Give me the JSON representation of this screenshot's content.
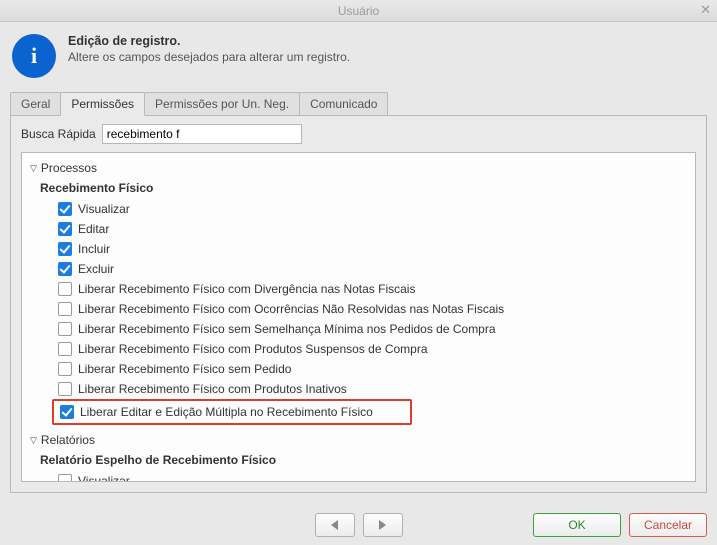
{
  "window": {
    "title": "Usuário"
  },
  "header": {
    "title": "Edição de registro.",
    "subtitle": "Altere os campos desejados para alterar um registro."
  },
  "tabs": [
    {
      "label": "Geral",
      "active": false
    },
    {
      "label": "Permissões",
      "active": true
    },
    {
      "label": "Permissões por Un. Neg.",
      "active": false
    },
    {
      "label": "Comunicado",
      "active": false
    }
  ],
  "search": {
    "label": "Busca Rápida",
    "value": "recebimento f"
  },
  "groups": {
    "processos": {
      "label": "Processos",
      "subgroups": {
        "recebimento_fisico": {
          "label": "Recebimento Físico",
          "items": [
            {
              "label": "Visualizar",
              "checked": true
            },
            {
              "label": "Editar",
              "checked": true
            },
            {
              "label": "Incluir",
              "checked": true
            },
            {
              "label": "Excluir",
              "checked": true
            },
            {
              "label": "Liberar Recebimento Físico com Divergência nas Notas Fiscais",
              "checked": false
            },
            {
              "label": "Liberar Recebimento Físico com Ocorrências Não Resolvidas nas Notas Fiscais",
              "checked": false
            },
            {
              "label": "Liberar Recebimento Físico sem Semelhança Mínima nos Pedidos de Compra",
              "checked": false
            },
            {
              "label": "Liberar Recebimento Físico com Produtos Suspensos de Compra",
              "checked": false
            },
            {
              "label": "Liberar Recebimento Físico sem Pedido",
              "checked": false
            },
            {
              "label": "Liberar Recebimento Físico com Produtos Inativos",
              "checked": false
            },
            {
              "label": "Liberar Editar e Edição Múltipla no Recebimento Físico",
              "checked": true,
              "highlight": true
            }
          ]
        }
      }
    },
    "relatorios": {
      "label": "Relatórios",
      "subgroups": {
        "espelho": {
          "label": "Relatório Espelho de Recebimento Físico",
          "items": [
            {
              "label": "Visualizar",
              "checked": false
            }
          ]
        }
      }
    }
  },
  "footer": {
    "ok_label": "OK",
    "cancel_label": "Cancelar"
  }
}
